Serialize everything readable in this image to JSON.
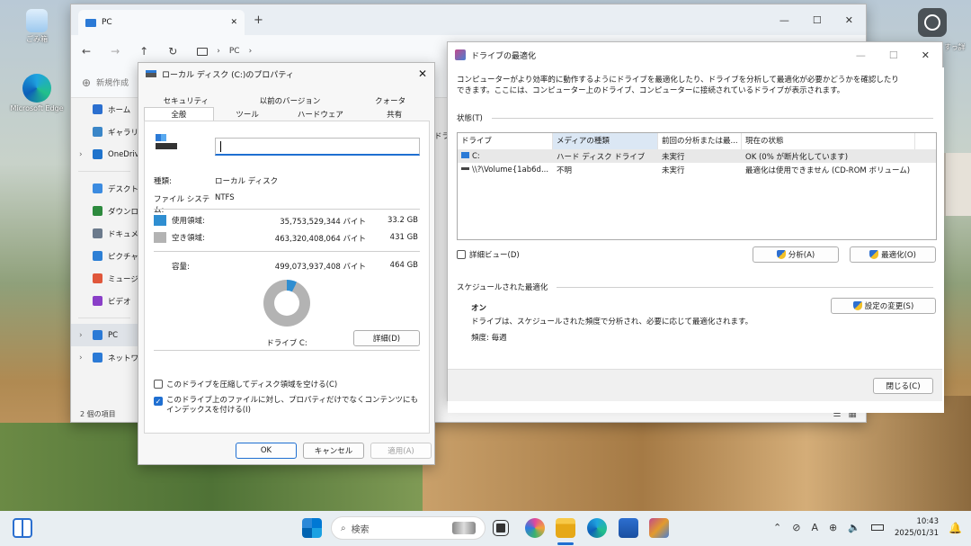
{
  "desktop": {
    "icons": [
      {
        "label": "ごみ箱",
        "icon": "recycle-bin-icon"
      },
      {
        "label": "Microsoft Edge",
        "icon": "edge-icon"
      }
    ],
    "top_right_fragment": "すっ詳"
  },
  "explorer": {
    "tab_title": "PC",
    "address": [
      "PC"
    ],
    "cmd_new": "新規作成",
    "sidebar": [
      {
        "label": "ホーム",
        "icon": "home-icon",
        "color": "#2b6fcf"
      },
      {
        "label": "ギャラリー",
        "icon": "gallery-icon",
        "color": "#3a86c8"
      },
      {
        "label": "OneDrive",
        "icon": "cloud-icon",
        "color": "#1f73cc",
        "chev": true
      },
      {
        "label": "デスクトップ",
        "icon": "desktop-icon",
        "color": "#3b8be0"
      },
      {
        "label": "ダウンロード",
        "icon": "download-icon",
        "color": "#2d8a3e"
      },
      {
        "label": "ドキュメント",
        "icon": "document-icon",
        "color": "#6b7a8c"
      },
      {
        "label": "ピクチャ",
        "icon": "pictures-icon",
        "color": "#2d7fd5"
      },
      {
        "label": "ミュージック",
        "icon": "music-icon",
        "color": "#e0573b"
      },
      {
        "label": "ビデオ",
        "icon": "video-icon",
        "color": "#8a3fc8"
      },
      {
        "label": "PC",
        "icon": "pc-icon",
        "color": "#2b7ad6",
        "chev": true,
        "selected": true
      },
      {
        "label": "ネットワーク",
        "icon": "network-icon",
        "color": "#2b7ad6",
        "chev": true
      }
    ],
    "status": "2 個の項目",
    "side_fragment": "ドラ"
  },
  "properties": {
    "title": "ローカル ディスク (C:)のプロパティ",
    "tabs_row1": [
      "セキュリティ",
      "以前のバージョン",
      "クォータ"
    ],
    "tabs_row2": [
      "全般",
      "ツール",
      "ハードウェア",
      "共有"
    ],
    "name_value": "",
    "type_label": "種類:",
    "type_value": "ローカル ディスク",
    "fs_label": "ファイル システム:",
    "fs_value": "NTFS",
    "used_label": "使用領域:",
    "used_bytes": "35,753,529,344 バイト",
    "used_gb": "33.2 GB",
    "used_color": "#2f8ed1",
    "free_label": "空き領域:",
    "free_bytes": "463,320,408,064 バイト",
    "free_gb": "431 GB",
    "free_color": "#b3b3b3",
    "capacity_label": "容量:",
    "capacity_bytes": "499,073,937,408 バイト",
    "capacity_gb": "464 GB",
    "used_fraction": 0.07,
    "drive_label": "ドライブ C:",
    "detail_button": "詳細(D)",
    "compress_label": "このドライブを圧縮してディスク領域を空ける(C)",
    "compress_checked": false,
    "index_label": "このドライブ上のファイルに対し、プロパティだけでなくコンテンツにもインデックスを付ける(I)",
    "index_checked": true,
    "ok": "OK",
    "cancel": "キャンセル",
    "apply": "適用(A)"
  },
  "defrag": {
    "title": "ドライブの最適化",
    "intro": "コンピューターがより効率的に動作するようにドライブを最適化したり、ドライブを分析して最適化が必要かどうかを確認したりできます。ここには、コンピューター上のドライブ、コンピューターに接続されているドライブが表示されます。",
    "status_label": "状態(T)",
    "columns": [
      "ドライブ",
      "メディアの種類",
      "前回の分析または最...",
      "現在の状態"
    ],
    "rows": [
      {
        "drive": "C:",
        "media": "ハード ディスク ドライブ",
        "last": "未実行",
        "status": "OK (0% が断片化しています)"
      },
      {
        "drive": "\\\\?\\Volume{1ab6d...",
        "media": "不明",
        "last": "未実行",
        "status": "最適化は使用できません (CD-ROM ボリューム)"
      }
    ],
    "detail_view": "詳細ビュー(D)",
    "analyze_button": "分析(A)",
    "optimize_button": "最適化(O)",
    "scheduled_label": "スケジュールされた最適化",
    "on": "オン",
    "schedule_desc": "ドライブは、スケジュールされた頻度で分析され、必要に応じて最適化されます。",
    "frequency": "頻度: 毎週",
    "change_settings": "設定の変更(S)",
    "close": "閉じる(C)"
  },
  "taskbar": {
    "search_placeholder": "検索",
    "time": "10:43",
    "date": "2025/01/31",
    "ime": "A"
  }
}
